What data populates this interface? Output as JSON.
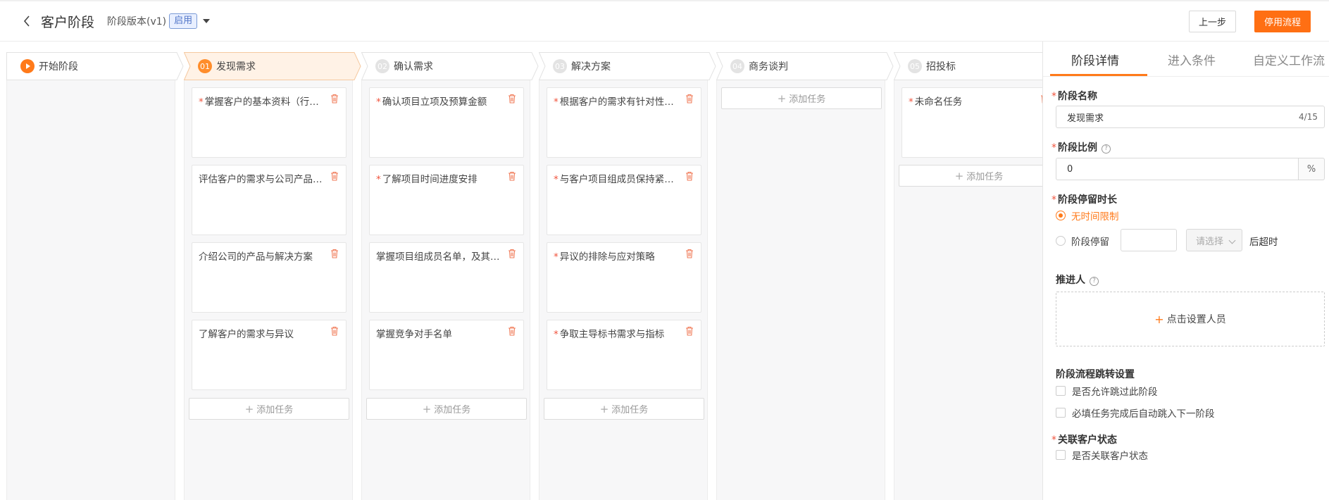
{
  "header": {
    "title": "客户阶段",
    "version_label": "阶段版本(v1)",
    "status_badge": "启用",
    "prev_button": "上一步",
    "stop_button": "停用流程"
  },
  "stages": [
    {
      "num": "",
      "label": "开始阶段",
      "active": false
    },
    {
      "num": "01",
      "label": "发现需求",
      "active": true
    },
    {
      "num": "02",
      "label": "确认需求",
      "active": false
    },
    {
      "num": "03",
      "label": "解决方案",
      "active": false
    },
    {
      "num": "04",
      "label": "商务谈判",
      "active": false
    },
    {
      "num": "05",
      "label": "招投标",
      "active": false
    }
  ],
  "columns": [
    {
      "tasks": []
    },
    {
      "tasks": [
        {
          "text": "掌握客户的基本资料（行业、规模等）",
          "required": true
        },
        {
          "text": "评估客户的需求与公司产品匹配度",
          "required": false
        },
        {
          "text": "介绍公司的产品与解决方案",
          "required": false
        },
        {
          "text": "了解客户的需求与异议",
          "required": false
        }
      ]
    },
    {
      "tasks": [
        {
          "text": "确认项目立项及预算金额",
          "required": true
        },
        {
          "text": "了解项目时间进度安排",
          "required": true
        },
        {
          "text": "掌握项目组成员名单，及其职责",
          "required": false
        },
        {
          "text": "掌握竞争对手名单",
          "required": false
        }
      ]
    },
    {
      "tasks": [
        {
          "text": "根据客户的需求有针对性地提供方案",
          "required": true
        },
        {
          "text": "与客户项目组成员保持紧密联系",
          "required": true
        },
        {
          "text": "异议的排除与应对策略",
          "required": true
        },
        {
          "text": "争取主导标书需求与指标",
          "required": true
        }
      ]
    },
    {
      "tasks": []
    },
    {
      "tasks": [
        {
          "text": "未命名任务",
          "required": true
        }
      ]
    }
  ],
  "add_task_label": "添加任务",
  "panel": {
    "tabs": [
      "阶段详情",
      "进入条件",
      "自定义工作流"
    ],
    "stage_name_label": "阶段名称",
    "stage_name_value": "发现需求",
    "stage_name_counter": "4/15",
    "ratio_label": "阶段比例",
    "ratio_value": "0",
    "ratio_suffix": "%",
    "stay_label": "阶段停留时长",
    "no_limit_label": "无时间限制",
    "stay_prefix": "阶段停留",
    "stay_select_placeholder": "请选择",
    "stay_suffix": "后超时",
    "promoter_label": "推进人",
    "set_person_label": "点击设置人员",
    "jump_label": "阶段流程跳转设置",
    "allow_skip_label": "是否允许跳过此阶段",
    "auto_jump_label": "必填任务完成后自动跳入下一阶段",
    "customer_status_label": "关联客户状态",
    "link_status_label": "是否关联客户状态"
  },
  "colors": {
    "accent": "#ff6f13",
    "active_stage_bg": "#fff2e6"
  }
}
